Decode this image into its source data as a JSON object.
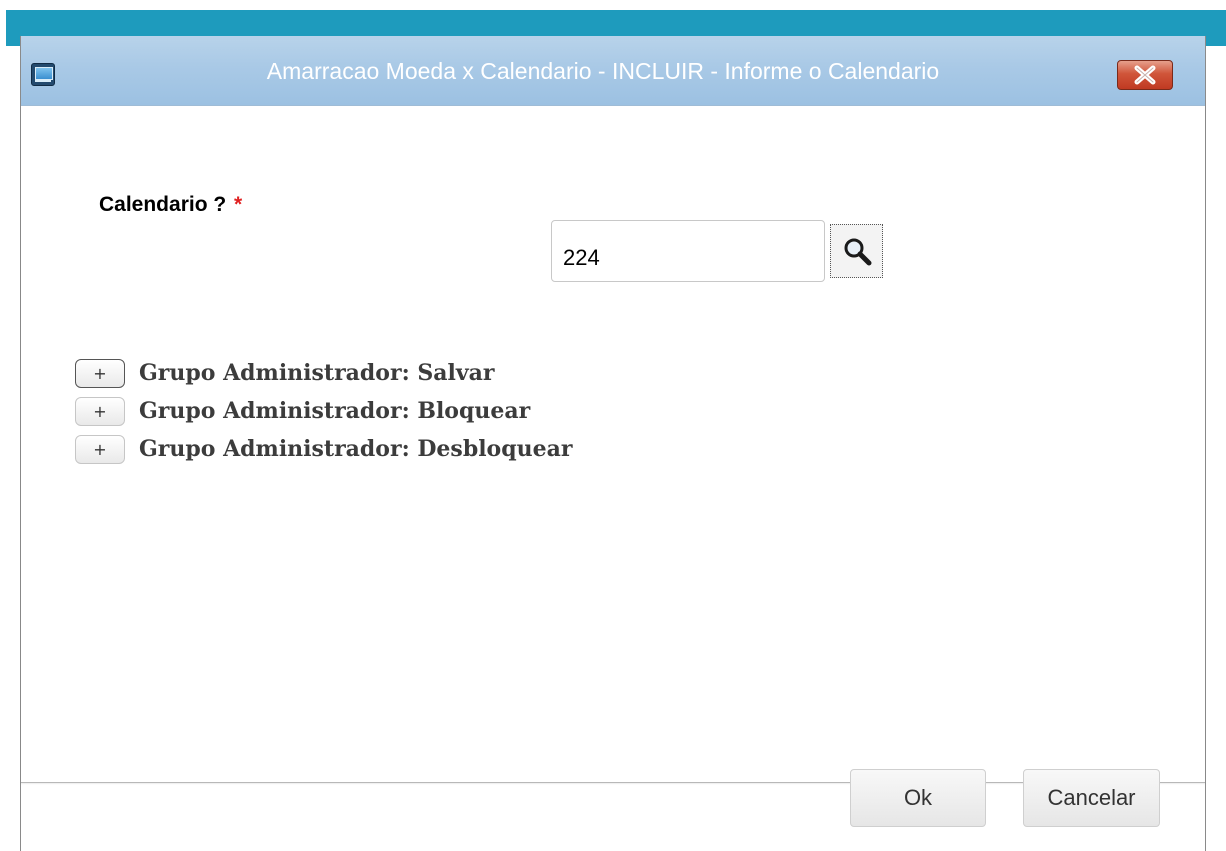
{
  "window": {
    "title": "Amarracao Moeda x Calendario - INCLUIR - Informe o Calendario",
    "app_icon": "computer-monitor-icon",
    "close_icon": "close-x-icon"
  },
  "form": {
    "field_label": "Calendario ?",
    "required_marker": "*",
    "field_value": "224",
    "lookup_icon": "magnifier-search-icon"
  },
  "tree": {
    "items": [
      {
        "expand_symbol": "+",
        "label": "Grupo Administrador: Salvar"
      },
      {
        "expand_symbol": "+",
        "label": "Grupo Administrador: Bloquear"
      },
      {
        "expand_symbol": "+",
        "label": "Grupo Administrador: Desbloquear"
      }
    ]
  },
  "footer": {
    "ok_label": "Ok",
    "cancel_label": "Cancelar"
  },
  "colors": {
    "top_bar": "#1e9bbd",
    "title_bar": "#a9c9e6",
    "close_button": "#c9452c",
    "required": "#e02020"
  }
}
